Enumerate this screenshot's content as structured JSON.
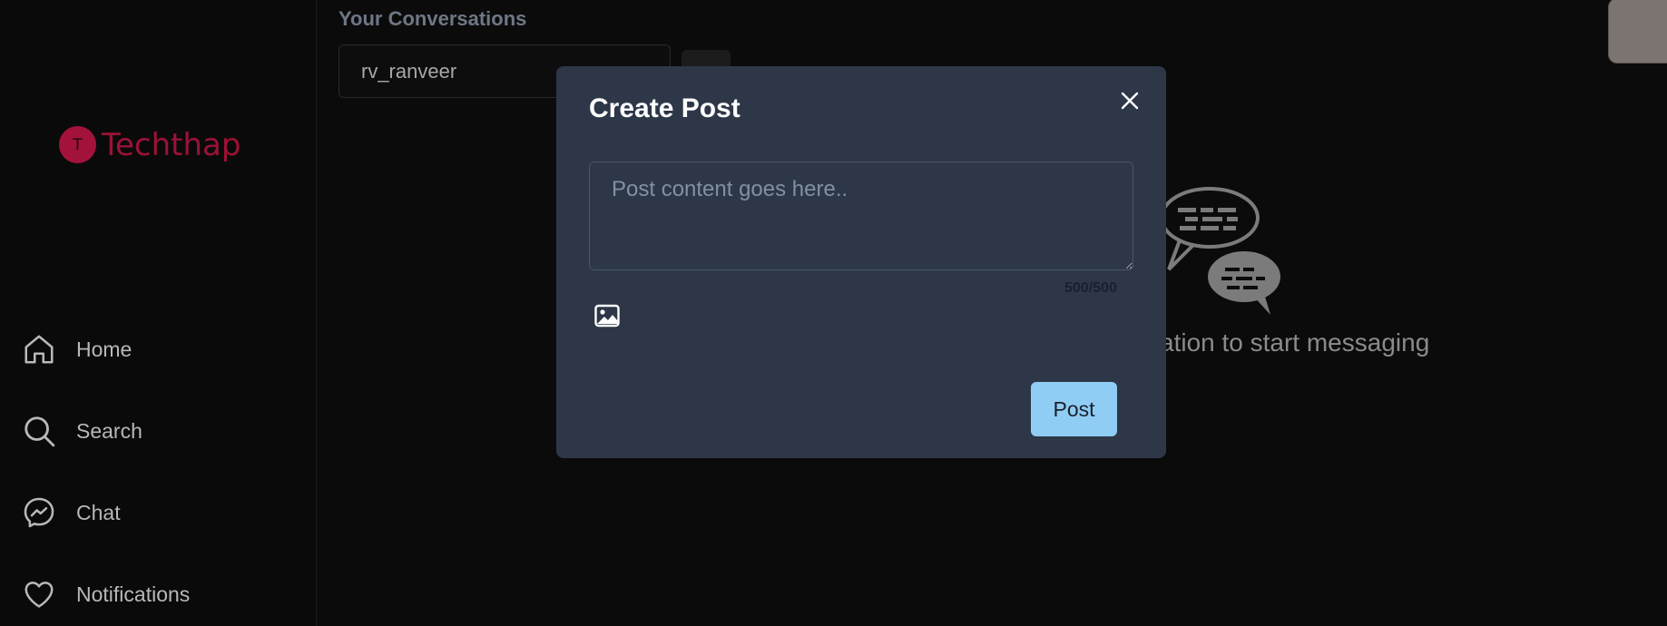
{
  "sidebar": {
    "logo_letter": "T",
    "logo_text": "Techthap",
    "items": [
      {
        "label": "Home",
        "icon": "home-icon"
      },
      {
        "label": "Search",
        "icon": "search-icon"
      },
      {
        "label": "Chat",
        "icon": "messenger-icon"
      },
      {
        "label": "Notifications",
        "icon": "heart-icon"
      }
    ]
  },
  "conversations": {
    "title": "Your Conversations",
    "search_value": "rv_ranveer",
    "empty_message": "sation to start messaging"
  },
  "modal": {
    "title": "Create Post",
    "placeholder": "Post content goes here..",
    "char_counter": "500/500",
    "post_label": "Post"
  },
  "colors": {
    "accent": "#90cdf4",
    "modal_bg": "#2d3748",
    "brand": "#a3123a",
    "page_bg": "#0b0b0b"
  }
}
